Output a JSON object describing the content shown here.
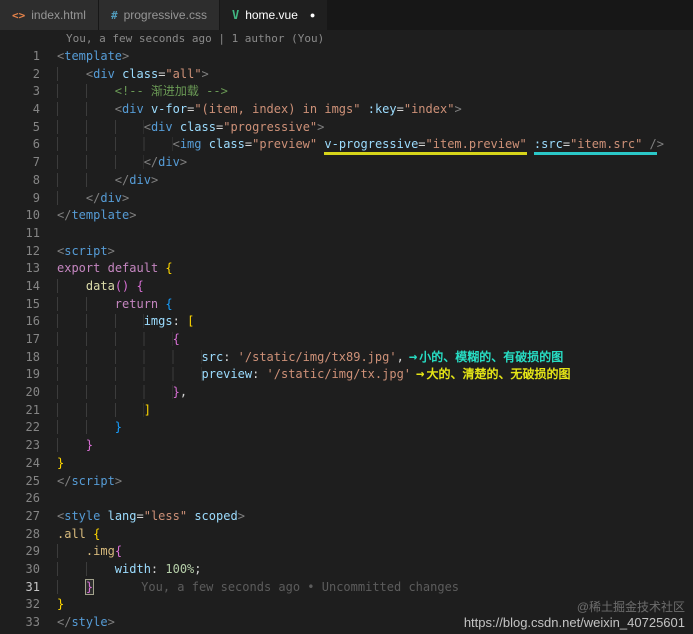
{
  "tabs": [
    {
      "label": "index.html",
      "icon_glyph": "<>",
      "active": false
    },
    {
      "label": "progressive.css",
      "icon_glyph": "#",
      "active": false
    },
    {
      "label": "home.vue",
      "icon_glyph": "V",
      "active": true,
      "dot": "●"
    }
  ],
  "blame_top": "You, a few seconds ago | 1 author (You)",
  "watermark": {
    "line1": "@稀土掘金技术社区",
    "line2": "https://blog.csdn.net/weixin_40725601"
  },
  "colors": {
    "background": "#1e1e1e",
    "annotation_cyan": "#27dcc3",
    "annotation_yellow": "#e5e516",
    "underline_yellow": "#d6d41a",
    "underline_cyan": "#2bc8c8"
  },
  "code": {
    "lines": [
      {
        "n": 1,
        "tokens": [
          {
            "t": "<",
            "c": "pn"
          },
          {
            "t": "template",
            "c": "tg"
          },
          {
            "t": ">",
            "c": "pn"
          }
        ]
      },
      {
        "n": 2,
        "ind": 4,
        "tokens": [
          {
            "t": "<",
            "c": "pn"
          },
          {
            "t": "div",
            "c": "tg"
          },
          {
            "t": " "
          },
          {
            "t": "class",
            "c": "at"
          },
          {
            "t": "=",
            "c": "eq"
          },
          {
            "t": "\"all\"",
            "c": "st"
          },
          {
            "t": ">",
            "c": "pn"
          }
        ]
      },
      {
        "n": 3,
        "ind": 8,
        "tokens": [
          {
            "t": "<!-- 渐进加载 -->",
            "c": "cm"
          }
        ]
      },
      {
        "n": 4,
        "ind": 8,
        "tokens": [
          {
            "t": "<",
            "c": "pn"
          },
          {
            "t": "div",
            "c": "tg"
          },
          {
            "t": " "
          },
          {
            "t": "v-for",
            "c": "at"
          },
          {
            "t": "=",
            "c": "eq"
          },
          {
            "t": "\"(item, index) in imgs\"",
            "c": "st"
          },
          {
            "t": " "
          },
          {
            "t": ":key",
            "c": "at"
          },
          {
            "t": "=",
            "c": "eq"
          },
          {
            "t": "\"index\"",
            "c": "st"
          },
          {
            "t": ">",
            "c": "pn"
          }
        ]
      },
      {
        "n": 5,
        "ind": 12,
        "tokens": [
          {
            "t": "<",
            "c": "pn"
          },
          {
            "t": "div",
            "c": "tg"
          },
          {
            "t": " "
          },
          {
            "t": "class",
            "c": "at"
          },
          {
            "t": "=",
            "c": "eq"
          },
          {
            "t": "\"progressive\"",
            "c": "st"
          },
          {
            "t": ">",
            "c": "pn"
          }
        ]
      },
      {
        "n": 6,
        "ind": 16,
        "tokens": [
          {
            "t": "<",
            "c": "pn"
          },
          {
            "t": "img",
            "c": "tg"
          },
          {
            "t": " "
          },
          {
            "t": "class",
            "c": "at"
          },
          {
            "t": "=",
            "c": "eq"
          },
          {
            "t": "\"preview\"",
            "c": "st"
          },
          {
            "t": " "
          },
          {
            "t": "v-progressive",
            "c": "at uy"
          },
          {
            "t": "=",
            "c": "eq uy"
          },
          {
            "t": "\"item.preview\"",
            "c": "st uy"
          },
          {
            "t": " "
          },
          {
            "t": ":src",
            "c": "at uc"
          },
          {
            "t": "=",
            "c": "eq uc"
          },
          {
            "t": "\"item.src\"",
            "c": "st uc"
          },
          {
            "t": " /",
            "c": "pn uc"
          },
          {
            "t": ">",
            "c": "pn"
          }
        ]
      },
      {
        "n": 7,
        "ind": 12,
        "tokens": [
          {
            "t": "</",
            "c": "pn"
          },
          {
            "t": "div",
            "c": "tg"
          },
          {
            "t": ">",
            "c": "pn"
          }
        ]
      },
      {
        "n": 8,
        "ind": 8,
        "tokens": [
          {
            "t": "</",
            "c": "pn"
          },
          {
            "t": "div",
            "c": "tg"
          },
          {
            "t": ">",
            "c": "pn"
          }
        ]
      },
      {
        "n": 9,
        "ind": 4,
        "tokens": [
          {
            "t": "</",
            "c": "pn"
          },
          {
            "t": "div",
            "c": "tg"
          },
          {
            "t": ">",
            "c": "pn"
          }
        ]
      },
      {
        "n": 10,
        "tokens": [
          {
            "t": "</",
            "c": "pn"
          },
          {
            "t": "template",
            "c": "tg"
          },
          {
            "t": ">",
            "c": "pn"
          }
        ]
      },
      {
        "n": 11,
        "tokens": []
      },
      {
        "n": 12,
        "tokens": [
          {
            "t": "<",
            "c": "pn"
          },
          {
            "t": "script",
            "c": "tg"
          },
          {
            "t": ">",
            "c": "pn"
          }
        ]
      },
      {
        "n": 13,
        "tokens": [
          {
            "t": "export",
            "c": "kw"
          },
          {
            "t": " "
          },
          {
            "t": "default",
            "c": "kw"
          },
          {
            "t": " "
          },
          {
            "t": "{",
            "c": "b1"
          }
        ]
      },
      {
        "n": 14,
        "ind": 4,
        "tokens": [
          {
            "t": "data",
            "c": "fn"
          },
          {
            "t": "()",
            "c": "b2"
          },
          {
            "t": " "
          },
          {
            "t": "{",
            "c": "b2"
          }
        ]
      },
      {
        "n": 15,
        "ind": 8,
        "tokens": [
          {
            "t": "return",
            "c": "kw"
          },
          {
            "t": " "
          },
          {
            "t": "{",
            "c": "b3"
          }
        ]
      },
      {
        "n": 16,
        "ind": 12,
        "tokens": [
          {
            "t": "imgs",
            "c": "pr"
          },
          {
            "t": ": "
          },
          {
            "t": "[",
            "c": "b1"
          }
        ]
      },
      {
        "n": 17,
        "ind": 16,
        "tokens": [
          {
            "t": "{",
            "c": "b2"
          }
        ]
      },
      {
        "n": 18,
        "ind": 20,
        "tokens": [
          {
            "t": "src",
            "c": "pr"
          },
          {
            "t": ": "
          },
          {
            "t": "'/static/img/tx89.jpg'",
            "c": "st"
          },
          {
            "t": ","
          },
          {
            "t": "→",
            "c": "ac ar"
          },
          {
            "t": "小的、模糊的、有破损的图",
            "c": "ac"
          }
        ]
      },
      {
        "n": 19,
        "ind": 20,
        "tokens": [
          {
            "t": "preview",
            "c": "pr"
          },
          {
            "t": ": "
          },
          {
            "t": "'/static/img/tx.jpg'",
            "c": "st"
          },
          {
            "t": "→",
            "c": "ay ar"
          },
          {
            "t": "大的、清楚的、无破损的图",
            "c": "ay"
          }
        ]
      },
      {
        "n": 20,
        "ind": 16,
        "tokens": [
          {
            "t": "}",
            "c": "b2"
          },
          {
            "t": ","
          }
        ]
      },
      {
        "n": 21,
        "ind": 12,
        "tokens": [
          {
            "t": "]",
            "c": "b1"
          }
        ]
      },
      {
        "n": 22,
        "ind": 8,
        "tokens": [
          {
            "t": "}",
            "c": "b3"
          }
        ]
      },
      {
        "n": 23,
        "ind": 4,
        "tokens": [
          {
            "t": "}",
            "c": "b2"
          }
        ]
      },
      {
        "n": 24,
        "tokens": [
          {
            "t": "}",
            "c": "b1"
          }
        ]
      },
      {
        "n": 25,
        "tokens": [
          {
            "t": "</",
            "c": "pn"
          },
          {
            "t": "script",
            "c": "tg"
          },
          {
            "t": ">",
            "c": "pn"
          }
        ]
      },
      {
        "n": 26,
        "tokens": []
      },
      {
        "n": 27,
        "tokens": [
          {
            "t": "<",
            "c": "pn"
          },
          {
            "t": "style",
            "c": "tg"
          },
          {
            "t": " "
          },
          {
            "t": "lang",
            "c": "at"
          },
          {
            "t": "=",
            "c": "eq"
          },
          {
            "t": "\"less\"",
            "c": "st"
          },
          {
            "t": " "
          },
          {
            "t": "scoped",
            "c": "at"
          },
          {
            "t": ">",
            "c": "pn"
          }
        ]
      },
      {
        "n": 28,
        "tokens": [
          {
            "t": ".all",
            "c": "cs"
          },
          {
            "t": " "
          },
          {
            "t": "{",
            "c": "b1"
          }
        ]
      },
      {
        "n": 29,
        "ind": 4,
        "tokens": [
          {
            "t": ".img",
            "c": "cs"
          },
          {
            "t": "{",
            "c": "b2"
          }
        ]
      },
      {
        "n": 30,
        "ind": 8,
        "tokens": [
          {
            "t": "width",
            "c": "pr"
          },
          {
            "t": ": "
          },
          {
            "t": "100%",
            "c": "nu"
          },
          {
            "t": ";"
          }
        ]
      },
      {
        "n": 31,
        "ind": 4,
        "active": true,
        "tokens": [
          {
            "t": "}",
            "c": "b2 bx"
          },
          {
            "t": "You, a few seconds ago • Uncommitted changes",
            "c": "bl"
          }
        ]
      },
      {
        "n": 32,
        "tokens": [
          {
            "t": "}",
            "c": "b1"
          }
        ]
      },
      {
        "n": 33,
        "tokens": [
          {
            "t": "</",
            "c": "pn"
          },
          {
            "t": "style",
            "c": "tg"
          },
          {
            "t": ">",
            "c": "pn"
          }
        ]
      }
    ]
  }
}
